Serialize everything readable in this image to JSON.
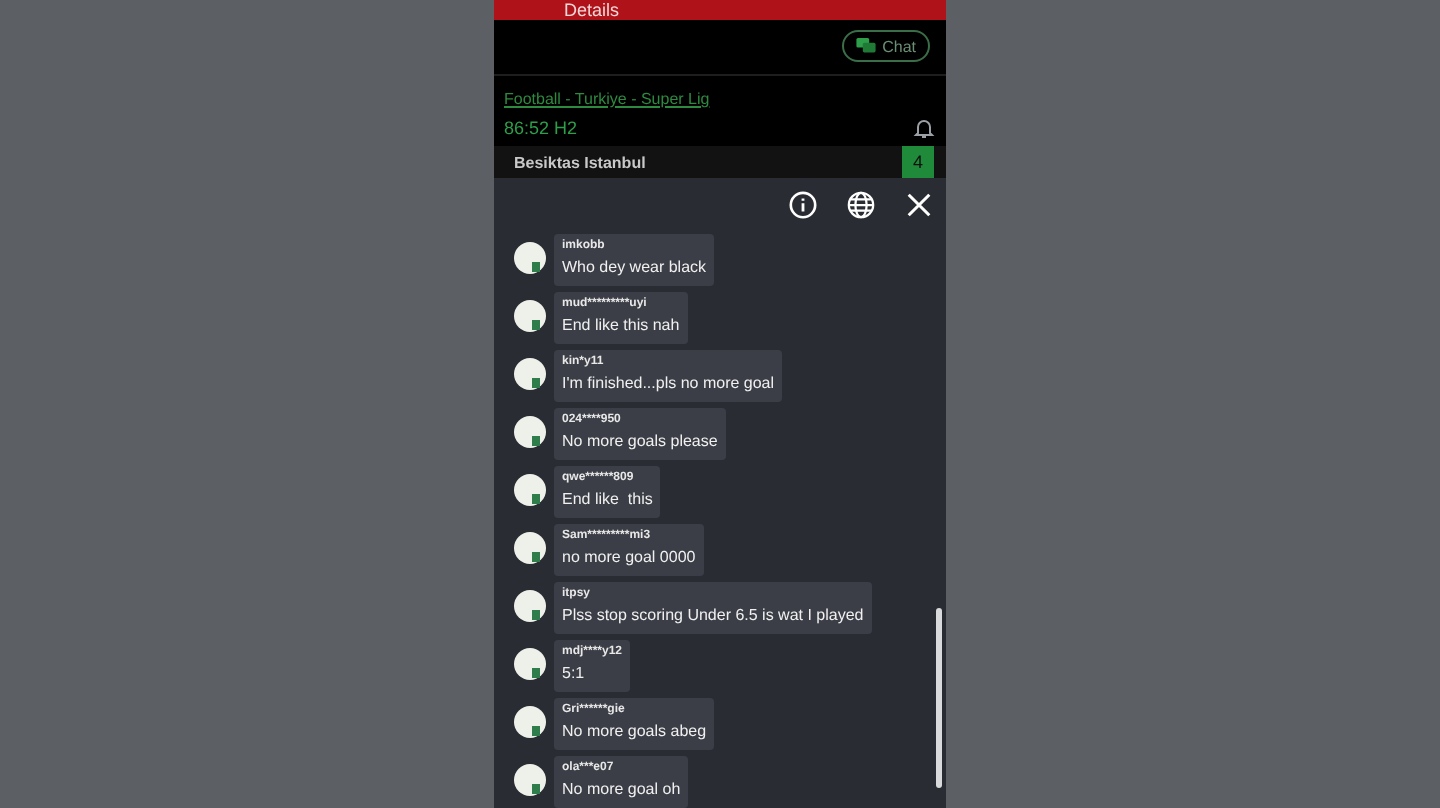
{
  "app_bar": {
    "title": "Details"
  },
  "chat_button": {
    "label": "Chat"
  },
  "match": {
    "league_link": "Football - Turkiye - Super Lig",
    "time": "86:52 H2",
    "team": "Besiktas Istanbul",
    "score": "4"
  },
  "messages": [
    {
      "user": "imkobb",
      "text": "Who dey wear black"
    },
    {
      "user": "mud*********uyi",
      "text": "End like this nah"
    },
    {
      "user": "kin*y11",
      "text": "I'm finished...pls no more goal"
    },
    {
      "user": "024****950",
      "text": "No more goals please"
    },
    {
      "user": "qwe******809",
      "text": "End like  this"
    },
    {
      "user": "Sam*********mi3",
      "text": "no more goal 0000"
    },
    {
      "user": "itpsy",
      "text": "Plss stop scoring Under 6.5 is wat I played"
    },
    {
      "user": "mdj****y12",
      "text": "5:1"
    },
    {
      "user": "Gri******gie",
      "text": "No more goals abeg"
    },
    {
      "user": "ola***e07",
      "text": "No more goal oh"
    }
  ]
}
